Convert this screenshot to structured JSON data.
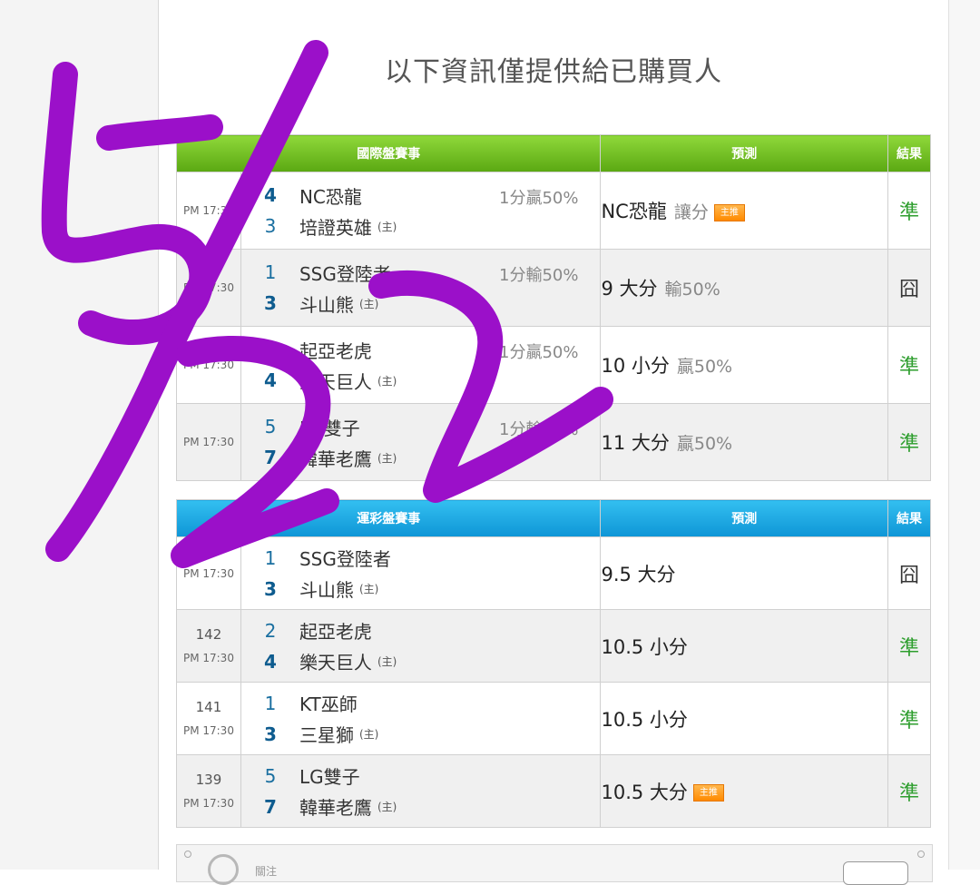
{
  "title": "以下資訊僅提供給已購買人",
  "colors": {
    "intl_header": "#66b61a",
    "lottery_header": "#18a5e3",
    "hit": "#2e9e2e",
    "scribble": "#9b10c9"
  },
  "intl": {
    "headers": {
      "event": "國際盤賽事",
      "prediction": "預測",
      "result": "結果"
    },
    "rows": [
      {
        "game_no": "",
        "time": "PM 17:30",
        "away_score": "4",
        "away": "NC恐龍",
        "home_score": "3",
        "home": "培證英雄",
        "host": "(主)",
        "spread": "1分贏50%",
        "pred": "NC恐龍",
        "pred_note": "讓分",
        "badge": "主推",
        "result": "準"
      },
      {
        "game_no": "",
        "time": "PM 17:30",
        "away_score": "1",
        "away": "SSG登陸者",
        "home_score": "3",
        "home": "斗山熊",
        "host": "(主)",
        "spread": "1分輸50%",
        "pred": "9 大分",
        "pred_note": "輸50%",
        "badge": "",
        "result": "囧"
      },
      {
        "game_no": "",
        "time": "PM 17:30",
        "away_score": "2",
        "away": "起亞老虎",
        "home_score": "4",
        "home": "樂天巨人",
        "host": "(主)",
        "spread": "1分贏50%",
        "pred": "10 小分",
        "pred_note": "贏50%",
        "badge": "",
        "result": "準"
      },
      {
        "game_no": "",
        "time": "PM 17:30",
        "away_score": "5",
        "away": "LG雙子",
        "home_score": "7",
        "home": "韓華老鷹",
        "host": "(主)",
        "spread": "1分輸50%",
        "pred": "11 大分",
        "pred_note": "贏50%",
        "badge": "",
        "result": "準"
      }
    ]
  },
  "lottery": {
    "headers": {
      "event": "運彩盤賽事",
      "prediction": "預測",
      "result": "結果"
    },
    "rows": [
      {
        "game_no": "",
        "time": "PM 17:30",
        "away_score": "1",
        "away": "SSG登陸者",
        "home_score": "3",
        "home": "斗山熊",
        "host": "(主)",
        "pred": "9.5 大分",
        "badge": "",
        "result": "囧"
      },
      {
        "game_no": "142",
        "time": "PM 17:30",
        "away_score": "2",
        "away": "起亞老虎",
        "home_score": "4",
        "home": "樂天巨人",
        "host": "(主)",
        "pred": "10.5 小分",
        "badge": "",
        "result": "準"
      },
      {
        "game_no": "141",
        "time": "PM 17:30",
        "away_score": "1",
        "away": "KT巫師",
        "home_score": "3",
        "home": "三星獅",
        "host": "(主)",
        "pred": "10.5 小分",
        "badge": "",
        "result": "準"
      },
      {
        "game_no": "139",
        "time": "PM 17:30",
        "away_score": "5",
        "away": "LG雙子",
        "home_score": "7",
        "home": "韓華老鷹",
        "host": "(主)",
        "pred": "10.5 大分",
        "badge": "主推",
        "result": "準"
      }
    ]
  },
  "footer": {
    "follow_label": "關注"
  }
}
